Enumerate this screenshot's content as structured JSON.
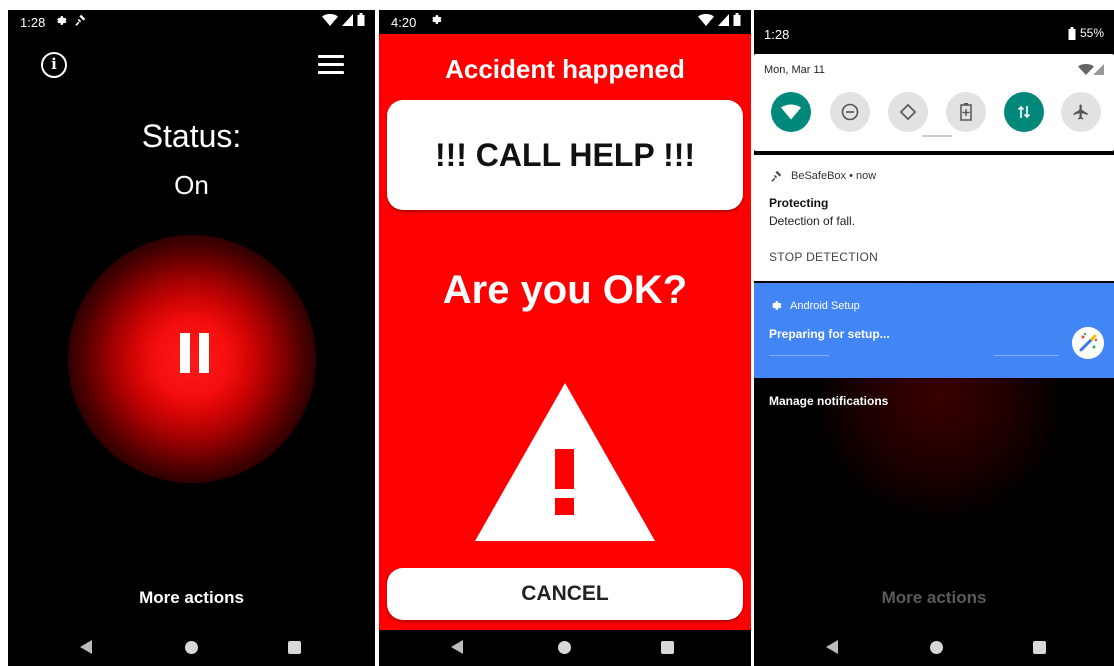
{
  "screen1": {
    "time": "1:28",
    "status_label": "Status:",
    "status_value": "On",
    "more_actions": "More actions"
  },
  "screen2": {
    "time": "4:20",
    "title": "Accident happened",
    "call_help": "!!! CALL HELP !!!",
    "question": "Are you OK?",
    "cancel": "CANCEL"
  },
  "screen3": {
    "time": "1:28",
    "battery": "55%",
    "date": "Mon, Mar 11",
    "notification1": {
      "app": "BeSafeBox • now",
      "title": "Protecting",
      "text": "Detection of fall.",
      "action": "STOP DETECTION"
    },
    "notification2": {
      "app": "Android Setup",
      "text": "Preparing for setup..."
    },
    "manage": "Manage notifications",
    "more_actions": "More actions"
  },
  "colors": {
    "alert_red": "#fe0000",
    "setup_blue": "#4285f4",
    "tile_on": "#00897b"
  },
  "icons": [
    "info-icon",
    "menu-icon",
    "pause-icon",
    "warning-icon",
    "gear-icon",
    "wifi-icon",
    "signal-icon",
    "battery-icon",
    "back-icon",
    "home-icon",
    "recents-icon"
  ]
}
